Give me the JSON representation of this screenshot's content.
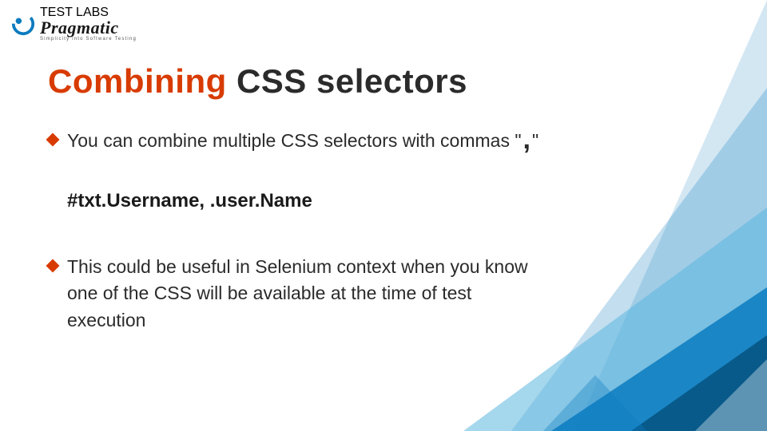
{
  "logo": {
    "top_line": "TEST LABS",
    "name": "Pragmatic",
    "sub_line": "Simplicity into Software Testing"
  },
  "title": {
    "accent": "Combining",
    "main": " CSS selectors"
  },
  "content": {
    "bullet1_prefix": "You can combine multiple CSS selectors with commas \"",
    "bullet1_comma": ",",
    "bullet1_suffix": "\"",
    "example": "#txt.Username, .user.Name",
    "bullet2": "This could be useful in Selenium context when you know one of the CSS will be available at the time of test execution"
  }
}
